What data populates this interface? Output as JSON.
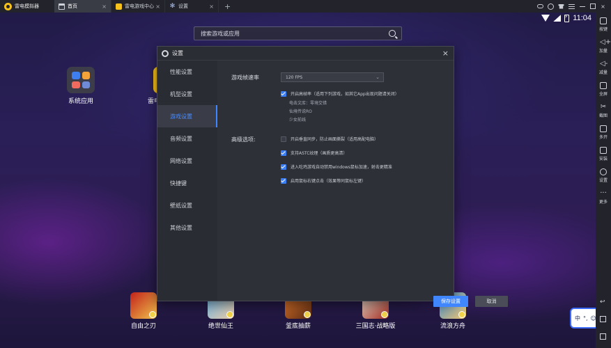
{
  "titlebar": {
    "app_title": "雷电模拟器",
    "tabs": [
      {
        "label": "首页",
        "icon": "home-icon"
      },
      {
        "label": "雷电游戏中心",
        "icon": "game-center-icon"
      },
      {
        "label": "设置",
        "icon": "gear-icon"
      }
    ],
    "add_tab": "+",
    "close_glyph": "×"
  },
  "status": {
    "time": "11:04"
  },
  "search": {
    "placeholder": "搜索游戏或应用"
  },
  "desktop": {
    "system_apps_label": "系统应用",
    "leidian_label": "雷电游戏中心",
    "dock": [
      {
        "label": "自由之刃",
        "colors": [
          "#c2211c",
          "#f0c24a"
        ]
      },
      {
        "label": "绝世仙王",
        "colors": [
          "#6db6e8",
          "#e9c9a5"
        ]
      },
      {
        "label": "釜底抽薪",
        "colors": [
          "#e4792d",
          "#5a2a12"
        ]
      },
      {
        "label": "三国志·战略版",
        "colors": [
          "#e9e2d4",
          "#a22a1e"
        ]
      },
      {
        "label": "流浪方舟",
        "colors": [
          "#3b8fd9",
          "#f2c36b"
        ]
      }
    ]
  },
  "ime": {
    "label": "中"
  },
  "dialog": {
    "title": "设置",
    "nav": [
      "性能设置",
      "机型设置",
      "游戏设置",
      "音频设置",
      "网络设置",
      "快捷键",
      "壁纸设置",
      "其他设置"
    ],
    "active_index": 2,
    "fps_label": "游戏帧速率",
    "fps_value": "120 FPS",
    "high_fps_option": "开启高帧率（适用下列游戏，如其它App出现问题请关闭）",
    "high_fps_games": [
      "电击文库：零境交错",
      "仙境传说RO",
      "少女前线"
    ],
    "advanced_label": "高级选项:",
    "advanced_options": [
      {
        "label": "开启垂直同步，防止画面撕裂（适用高配电脑）",
        "checked": false
      },
      {
        "label": "支持ASTC纹理（画质更高清）",
        "checked": true
      },
      {
        "label": "进入吃鸡游戏自动禁用windows鼠标加速，射击更精准",
        "checked": true
      },
      {
        "label": "启用鼠标右键点击（效果等同鼠标左键）",
        "checked": true
      }
    ],
    "save_label": "保存设置",
    "cancel_label": "取消"
  },
  "toolbar": {
    "items": [
      {
        "label": "按键",
        "icon": "keyboard-icon"
      },
      {
        "label": "加量",
        "icon": "volume-up-icon"
      },
      {
        "label": "减量",
        "icon": "volume-down-icon"
      },
      {
        "label": "全屏",
        "icon": "fullscreen-icon"
      },
      {
        "label": "截图",
        "icon": "scissors-icon"
      },
      {
        "label": "多开",
        "icon": "multi-instance-icon"
      },
      {
        "label": "安装",
        "icon": "apk-install-icon"
      },
      {
        "label": "设置",
        "icon": "settings-gear-icon"
      },
      {
        "label": "更多",
        "icon": "more-icon"
      }
    ]
  },
  "colors": {
    "accent": "#3f86ff",
    "dialog_bg": "#2e3038",
    "titlebar_bg": "#23242b"
  }
}
